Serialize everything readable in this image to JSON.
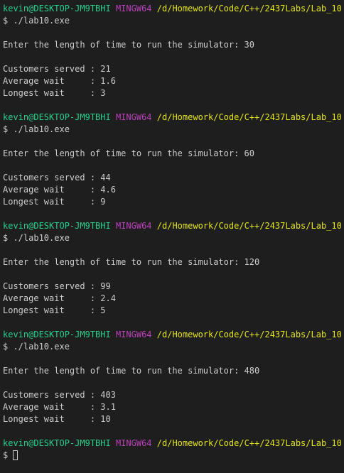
{
  "prompt": {
    "user": "kevin@DESKTOP-JM9TBHI",
    "shell": "MINGW64",
    "path": "/d/Homework/Code/C++/2437Labs/Lab_10",
    "symbol": "$"
  },
  "runs": [
    {
      "command": "$ ./lab10.exe",
      "input_line": "Enter the length of time to run the simulator: 30",
      "served": "Customers served : 21",
      "average": "Average wait     : 1.6",
      "longest": "Longest wait     : 3"
    },
    {
      "command": "$ ./lab10.exe",
      "input_line": "Enter the length of time to run the simulator: 60",
      "served": "Customers served : 44",
      "average": "Average wait     : 4.6",
      "longest": "Longest wait     : 9"
    },
    {
      "command": "$ ./lab10.exe",
      "input_line": "Enter the length of time to run the simulator: 120",
      "served": "Customers served : 99",
      "average": "Average wait     : 2.4",
      "longest": "Longest wait     : 5"
    },
    {
      "command": "$ ./lab10.exe",
      "input_line": "Enter the length of time to run the simulator: 480",
      "served": "Customers served : 403",
      "average": "Average wait     : 3.1",
      "longest": "Longest wait     : 10"
    }
  ],
  "colors": {
    "background": "#1e1e1e",
    "text": "#cccccc",
    "user": "#23d18b",
    "shell": "#bc3fbc",
    "path": "#e5e510"
  }
}
